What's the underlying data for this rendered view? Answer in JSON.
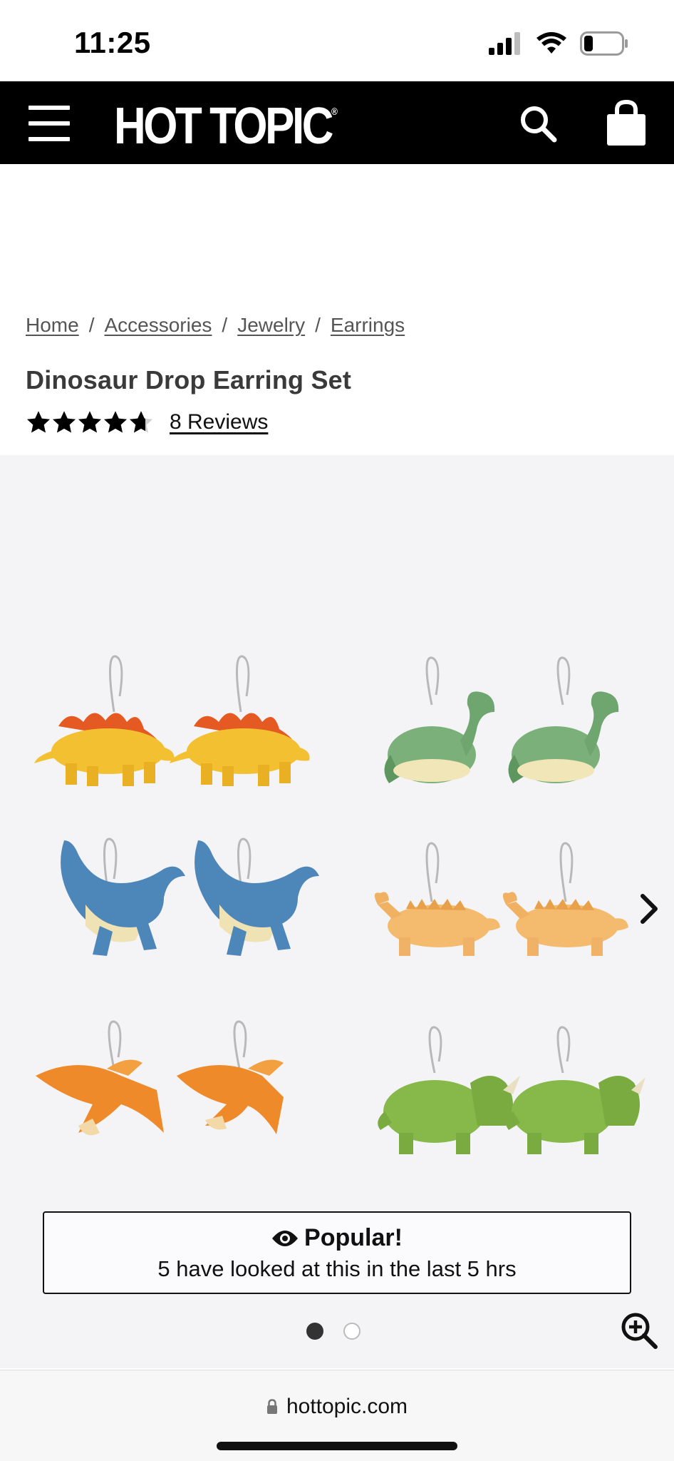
{
  "status_bar": {
    "time": "11:25"
  },
  "header": {
    "logo_text": "HOT TOPIC",
    "logo_mark": "®"
  },
  "breadcrumb": {
    "items": [
      "Home",
      "Accessories",
      "Jewelry",
      "Earrings"
    ],
    "separator": "/"
  },
  "product": {
    "title": "Dinosaur Drop Earring Set",
    "rating": 4.5,
    "rating_max": 5,
    "reviews_label": "8 Reviews"
  },
  "popular": {
    "title": "Popular!",
    "text": "5 have looked at this in the last 5 hrs"
  },
  "gallery": {
    "slide_count": 2,
    "active_slide": 1
  },
  "browser": {
    "url": "hottopic.com"
  },
  "colors": {
    "header_bg": "#000000",
    "gallery_bg": "#f4f4f6"
  }
}
